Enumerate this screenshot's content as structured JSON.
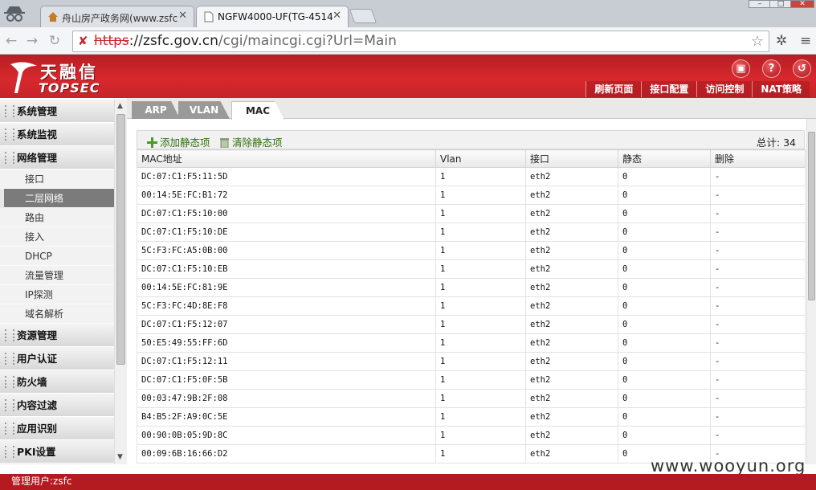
{
  "browser": {
    "tabs": [
      {
        "title": "舟山房产政务网(www.zsfc",
        "active": false
      },
      {
        "title": "NGFW4000-UF(TG-4514",
        "active": true
      }
    ],
    "url": {
      "scheme": "https",
      "host": "://zsfc.gov.cn",
      "path": "/cgi/maincgi.cgi?Url=Main"
    }
  },
  "header": {
    "logo_cn": "天融信",
    "logo_en": "TOPSEC",
    "icons": [
      "save-icon",
      "help-icon",
      "logout-icon"
    ],
    "menu": [
      "刷新页面",
      "接口配置",
      "访问控制",
      "NAT策略"
    ]
  },
  "sidebar": {
    "sections_top": [
      "系统管理",
      "系统监视",
      "网络管理"
    ],
    "items": [
      "接口",
      "二层网络",
      "路由",
      "接入",
      "DHCP",
      "流量管理",
      "IP探测",
      "域名解析"
    ],
    "active_item": "二层网络",
    "sections_bottom": [
      "资源管理",
      "用户认证",
      "防火墙",
      "内容过滤",
      "应用识别",
      "PKI设置"
    ]
  },
  "main": {
    "tabs": [
      "ARP",
      "VLAN",
      "MAC"
    ],
    "active_tab": "MAC",
    "add_label": "添加静态项",
    "clear_label": "清除静态项",
    "total_label": "总计: 34",
    "columns": [
      "MAC地址",
      "Vlan",
      "接口",
      "静态",
      "删除"
    ],
    "rows": [
      [
        "DC:07:C1:F5:11:5D",
        "1",
        "eth2",
        "0",
        "-"
      ],
      [
        "00:14:5E:FC:B1:72",
        "1",
        "eth2",
        "0",
        "-"
      ],
      [
        "DC:07:C1:F5:10:00",
        "1",
        "eth2",
        "0",
        "-"
      ],
      [
        "DC:07:C1:F5:10:DE",
        "1",
        "eth2",
        "0",
        "-"
      ],
      [
        "5C:F3:FC:A5:0B:00",
        "1",
        "eth2",
        "0",
        "-"
      ],
      [
        "DC:07:C1:F5:10:EB",
        "1",
        "eth2",
        "0",
        "-"
      ],
      [
        "00:14:5E:FC:81:9E",
        "1",
        "eth2",
        "0",
        "-"
      ],
      [
        "5C:F3:FC:4D:8E:F8",
        "1",
        "eth2",
        "0",
        "-"
      ],
      [
        "DC:07:C1:F5:12:07",
        "1",
        "eth2",
        "0",
        "-"
      ],
      [
        "50:E5:49:55:FF:6D",
        "1",
        "eth2",
        "0",
        "-"
      ],
      [
        "DC:07:C1:F5:12:11",
        "1",
        "eth2",
        "0",
        "-"
      ],
      [
        "DC:07:C1:F5:0F:5B",
        "1",
        "eth2",
        "0",
        "-"
      ],
      [
        "00:03:47:9B:2F:08",
        "1",
        "eth2",
        "0",
        "-"
      ],
      [
        "B4:B5:2F:A9:0C:5E",
        "1",
        "eth2",
        "0",
        "-"
      ],
      [
        "00:90:0B:05:9D:8C",
        "1",
        "eth2",
        "0",
        "-"
      ],
      [
        "00:09:6B:16:66:D2",
        "1",
        "eth2",
        "0",
        "-"
      ]
    ]
  },
  "status": {
    "text": "管理用户:zsfc"
  },
  "watermark": "www.wooyun.org"
}
